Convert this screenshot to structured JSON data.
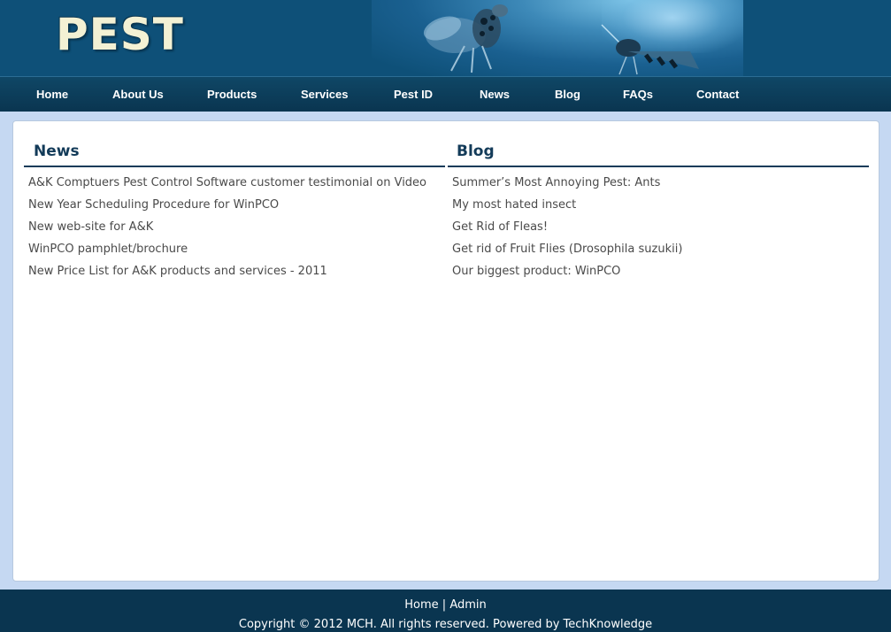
{
  "header": {
    "logo_text": "PEST"
  },
  "nav": {
    "items": [
      {
        "label": "Home"
      },
      {
        "label": "About Us"
      },
      {
        "label": "Products"
      },
      {
        "label": "Services"
      },
      {
        "label": "Pest ID"
      },
      {
        "label": "News"
      },
      {
        "label": "Blog"
      },
      {
        "label": "FAQs"
      },
      {
        "label": "Contact"
      }
    ]
  },
  "news": {
    "title": "News",
    "items": [
      "A&K Comptuers Pest Control Software customer testimonial on Video",
      "New Year Scheduling Procedure for WinPCO",
      "New web-site for A&K",
      "WinPCO pamphlet/brochure",
      "New Price List for A&K products and services - 2011"
    ]
  },
  "blog": {
    "title": "Blog",
    "items": [
      "Summer’s Most Annoying Pest: Ants",
      "My most hated insect",
      "Get Rid of Fleas!",
      "Get rid of Fruit Flies (Drosophila suzukii)",
      "Our biggest product: WinPCO"
    ]
  },
  "footer": {
    "link_home": "Home",
    "separator": "|",
    "link_admin": "Admin",
    "copyright": "Copyright © 2012 MCH. All rights reserved. Powered by TechKnowledge"
  },
  "colors": {
    "header_bg": "#0e5078",
    "nav_bg": "#0a3550",
    "page_bg": "#c5d8f2",
    "heading": "#133b59",
    "link_text": "#4a4a4a",
    "logo": "#f3f1d4"
  }
}
